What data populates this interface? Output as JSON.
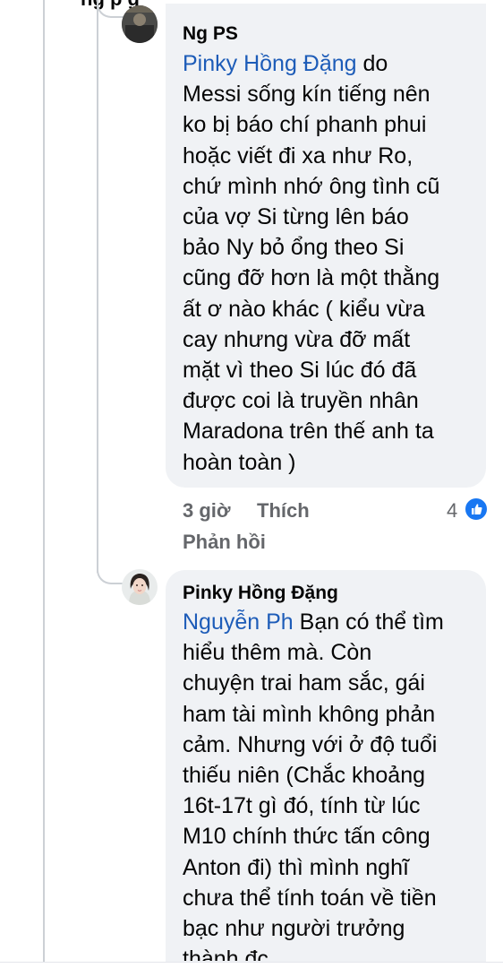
{
  "top_partial": "ng  p                g",
  "comment1": {
    "author": "Ng PS",
    "mention": "Pinky Hồng Đặng",
    "lines": [
      " do",
      "Messi sống kín tiếng nên",
      "ko bị báo chí phanh phui",
      "hoặc viết đi xa như Ro,",
      "chứ mình nhớ ông tình cũ",
      "của vợ Si từng lên báo",
      "bảo Ny bỏ ổng theo Si",
      "cũng đỡ hơn là một thằng",
      "ất ơ nào khác ( kiểu vừa",
      "cay nhưng vừa đỡ mất",
      "mặt vì theo Si lúc đó đã",
      "được coi là truyền nhân",
      "Maradona trên thế anh ta",
      "hoàn toàn )"
    ],
    "time": "3 giờ",
    "like_label": "Thích",
    "reply_label": "Phản hồi",
    "reaction_count": "4"
  },
  "comment2": {
    "author": "Pinky Hồng Đặng",
    "mention": "Nguyễn Ph",
    "lines": [
      " Bạn có thể tìm",
      "hiểu thêm mà. Còn",
      "chuyện trai ham sắc, gái",
      "ham tài mình không phản",
      "cảm. Nhưng với ở độ tuổi",
      "thiếu niên (Chắc khoảng",
      "16t-17t gì đó, tính từ lúc",
      "M10 chính thức tấn công",
      "Anton đi) thì mình nghĩ",
      "chưa thể tính toán về tiền",
      "bạc như người trưởng",
      "thành đc"
    ]
  },
  "colors": {
    "bubble": "#f0f2f5",
    "mention": "#1d5cb8",
    "meta": "#65676b",
    "like": "#1877f2"
  }
}
